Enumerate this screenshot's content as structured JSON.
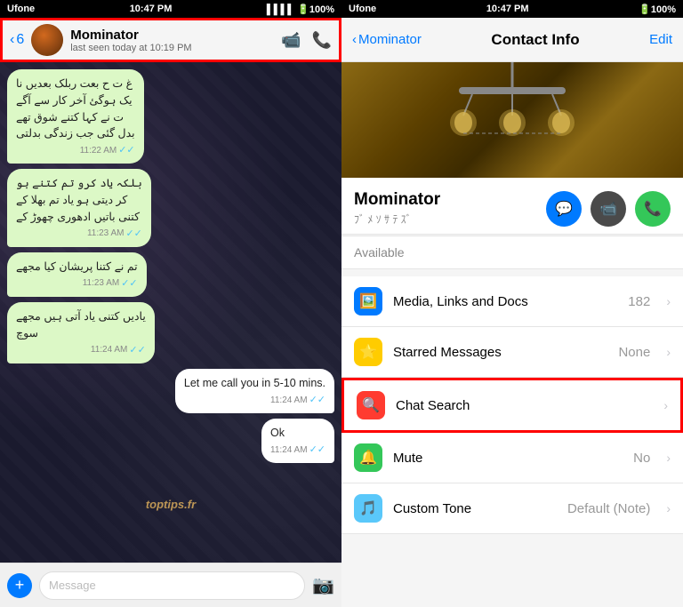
{
  "app": {
    "left_panel": "chat",
    "right_panel": "contact_info"
  },
  "status_bar_left": {
    "carrier": "Ufone",
    "time": "10:47 PM",
    "battery": "100%",
    "signal": "4"
  },
  "status_bar_right": {
    "carrier": "Ufone",
    "time": "10:47 PM",
    "battery": "100%"
  },
  "chat_header": {
    "back_label": "6",
    "contact_name": "Mominator",
    "contact_status": "last seen today at 10:19 PM",
    "video_icon": "📹",
    "call_icon": "📞"
  },
  "messages": [
    {
      "id": 1,
      "type": "incoming",
      "text": "غ ت ح بعت ربلك بعدین نا\nیک ہوگئ آخر کار سے آگے\nت نے کہا کتنے شوق تھے\nبدل گئی جب زندگی بدلتی",
      "time": "11:22 AM",
      "read": true
    },
    {
      "id": 2,
      "type": "incoming",
      "text": "بلکہ یاد کرو تم کتنے ہو\nکر دیتی ہو یاد تم بھلا کے\nکتنی باتیں ادھوری چھوڑ کے",
      "time": "11:23 AM",
      "read": true
    },
    {
      "id": 3,
      "type": "incoming",
      "text": "تم نے کتنا پریشان کیا مجھے",
      "time": "11:23 AM",
      "read": true
    },
    {
      "id": 4,
      "type": "incoming",
      "text": "یادیں کتنی یاد آتی ہیں مجھے\nسوچ",
      "time": "11:24 AM",
      "read": true
    },
    {
      "id": 5,
      "type": "outgoing",
      "text": "Let me call you in 5-10 mins.",
      "time": "11:24 AM",
      "read": true
    },
    {
      "id": 6,
      "type": "outgoing",
      "text": "Ok",
      "time": "11:24 AM",
      "read": true
    }
  ],
  "watermark": "toptips.fr",
  "contact_info_header": {
    "back_label": "Mominator",
    "title": "Contact Info",
    "edit_label": "Edit"
  },
  "contact_details": {
    "name": "Mominator",
    "subtitle": "ﾌﾞ ﾒ ｿ ｻ ﾃ ｽﾞ",
    "status": "Available"
  },
  "action_buttons": {
    "message": "💬",
    "video": "📹",
    "phone": "📞"
  },
  "menu_items": [
    {
      "id": "media",
      "icon": "🖼️",
      "icon_type": "blue",
      "label": "Media, Links and Docs",
      "value": "182",
      "chevron": "›"
    },
    {
      "id": "starred",
      "icon": "⭐",
      "icon_type": "yellow",
      "label": "Starred Messages",
      "value": "None",
      "chevron": "›"
    },
    {
      "id": "chat_search",
      "icon": "🔍",
      "icon_type": "red",
      "label": "Chat Search",
      "value": "",
      "chevron": "›",
      "highlighted": true
    },
    {
      "id": "mute",
      "icon": "🔔",
      "icon_type": "green",
      "label": "Mute",
      "value": "No",
      "chevron": "›"
    },
    {
      "id": "custom_tone",
      "icon": "🎵",
      "icon_type": "teal",
      "label": "Custom Tone",
      "value": "Default (Note)",
      "chevron": "›"
    }
  ],
  "input_placeholder": "Message"
}
